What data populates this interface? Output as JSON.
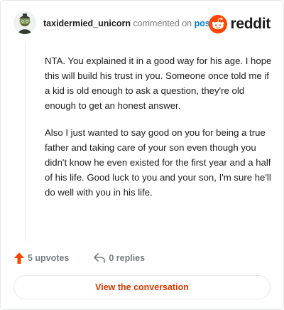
{
  "header": {
    "username": "taxidermied_unicorn",
    "commented_on": "commented on",
    "post_link": "post",
    "brand": "reddit"
  },
  "comment": {
    "paragraphs": [
      "NTA. You explained it in a good way for his age. I hope this will build his trust in you. Someone once told me if a kid is old enough to ask a question, they're old enough to get an honest answer.",
      "Also I just wanted to say good on you for being a true father and taking care of your son even though you didn't know he even existed for the first year and a half of his life. Good luck to you and your son, I'm sure he'll do well with you in his life."
    ]
  },
  "actions": {
    "upvotes": "5 upvotes",
    "replies": "0 replies"
  },
  "footer": {
    "view_label": "View the conversation"
  },
  "colors": {
    "accent": "#ff4500",
    "link": "#0079d3",
    "cta": "#d93a00"
  },
  "icons": {
    "upvote": "upvote-arrow-icon",
    "reply": "reply-arrow-icon",
    "brand": "reddit-snoo-icon",
    "avatar": "user-avatar"
  }
}
